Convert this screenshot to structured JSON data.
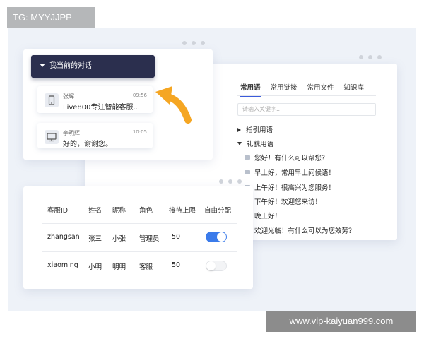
{
  "watermark_top": "TG: MYYJJPP",
  "watermark_bottom": "www.vip-kaiyuan999.com",
  "chat": {
    "header": "我当前的对话",
    "conversations": [
      {
        "name": "张辉",
        "time": "09:56",
        "message": "Live800专注智能客服...",
        "icon": "mobile-icon"
      },
      {
        "name": "李明辉",
        "time": "10:05",
        "message": "好的，谢谢您。",
        "icon": "desktop-icon"
      }
    ]
  },
  "phrases": {
    "tabs": [
      "常用语",
      "常用链接",
      "常用文件",
      "知识库"
    ],
    "active_tab": "常用语",
    "search_placeholder": "请输入关键字...",
    "categories": [
      {
        "label": "指引用语",
        "expanded": false
      },
      {
        "label": "礼貌用语",
        "expanded": true
      }
    ],
    "items": [
      "您好！有什么可以帮您？",
      "早上好，常用早上问候语！",
      "上午好！很高兴为您服务！",
      "下午好！欢迎您来访！",
      "晚上好！",
      "欢迎光临！有什么可以为您效劳？"
    ]
  },
  "agents": {
    "headers": [
      "客服ID",
      "姓名",
      "昵称",
      "角色",
      "接待上限",
      "自由分配"
    ],
    "rows": [
      {
        "id": "zhangsan",
        "name": "张三",
        "nickname": "小张",
        "role": "管理员",
        "limit": "50",
        "auto_assign": true
      },
      {
        "id": "xiaoming",
        "name": "小明",
        "nickname": "明明",
        "role": "客服",
        "limit": "50",
        "auto_assign": false
      }
    ]
  },
  "colors": {
    "accent": "#3b7bea",
    "header_dark": "#2b2f4e",
    "arrow": "#f5a623"
  }
}
